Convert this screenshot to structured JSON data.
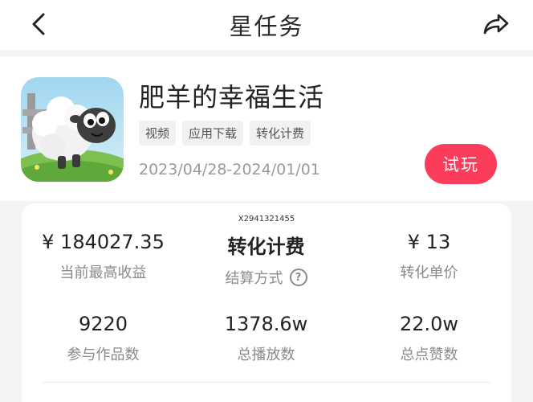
{
  "header": {
    "title": "星任务",
    "back_icon": "chevron-left-icon",
    "share_icon": "share-arrow-icon"
  },
  "app": {
    "name": "肥羊的幸福生活",
    "tags": [
      "视频",
      "应用下载",
      "转化计费"
    ],
    "date_range": "2023/04/28-2024/01/01",
    "try_label": "试玩",
    "accent_color": "#fb3c5a"
  },
  "stats": {
    "watermark": "X2941321455",
    "items": [
      {
        "value": "¥ 184027.35",
        "label": "当前最高收益"
      },
      {
        "value": "转化计费",
        "label": "结算方式",
        "help": "?"
      },
      {
        "value": "¥ 13",
        "label": "转化单价"
      },
      {
        "value": "9220",
        "label": "参与作品数"
      },
      {
        "value": "1378.6w",
        "label": "总播放数"
      },
      {
        "value": "22.0w",
        "label": "总点赞数"
      }
    ]
  }
}
